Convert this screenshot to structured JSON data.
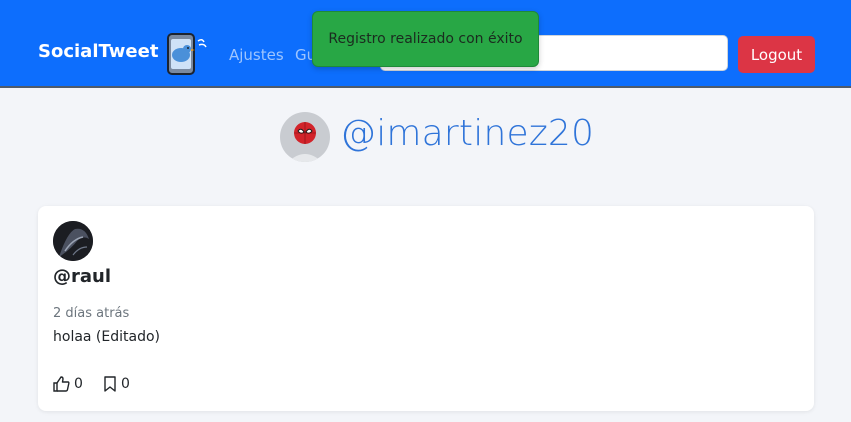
{
  "navbar": {
    "brand": "SocialTweet",
    "links": [
      "Ajustes",
      "Gu"
    ],
    "search_value": "",
    "logout_label": "Logout"
  },
  "toast": {
    "message": "Registro realizado con éxito"
  },
  "profile": {
    "handle": "@imartinez20"
  },
  "post": {
    "user": "@raul",
    "time": "2 días atrás",
    "text": "holaa (Editado)",
    "likes": "0",
    "saves": "0"
  },
  "colors": {
    "navbar": "#0d6efd",
    "logout": "#dc3545",
    "toast": "#28a745",
    "handle": "#2f74d9"
  }
}
